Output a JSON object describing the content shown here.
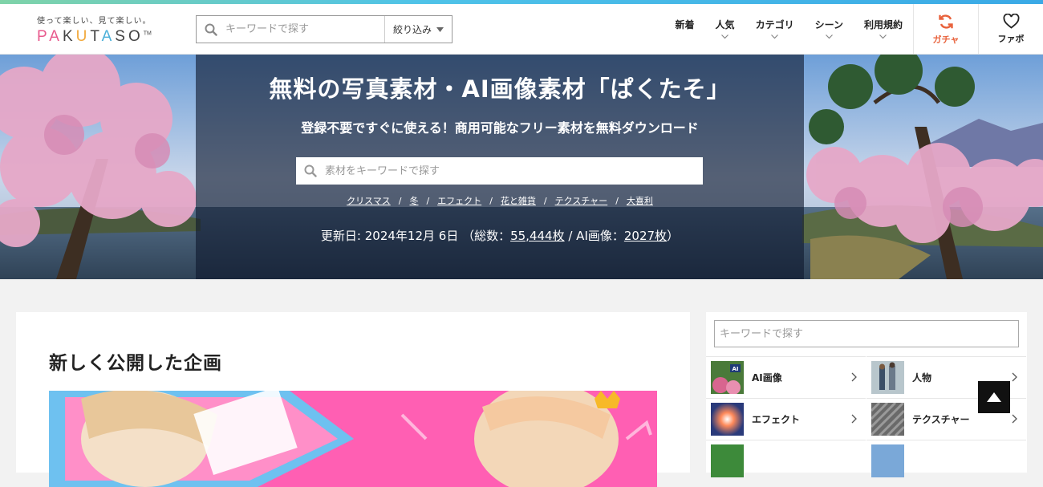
{
  "header": {
    "logo_tagline": "使って楽しい、見て楽しい。",
    "logo_parts": [
      "PA",
      "K",
      "U",
      "T",
      "A",
      "S",
      "O"
    ],
    "logo_tm": "TM",
    "search_placeholder": "キーワードで探す",
    "filter_label": "絞り込み",
    "nav": [
      {
        "label": "新着"
      },
      {
        "label": "人気"
      },
      {
        "label": "カテゴリ"
      },
      {
        "label": "シーン"
      },
      {
        "label": "利用規約"
      }
    ],
    "gacha_label": "ガチャ",
    "fav_label": "ファボ"
  },
  "hero": {
    "title": "無料の写真素材・AI画像素材「ぱくたそ」",
    "subtitle": "登録不要ですぐに使える！商用可能なフリー素材を無料ダウンロード",
    "search_placeholder": "素材をキーワードで探す",
    "tags": [
      "クリスマス",
      "冬",
      "エフェクト",
      "花と雑貨",
      "テクスチャー",
      "大喜利"
    ],
    "separator": "/",
    "update_prefix": "更新日: 2024年12月 6日 （総数：",
    "total_count": "55,444枚",
    "ai_prefix": " / AI画像：",
    "ai_count": "2027枚",
    "update_suffix": "）"
  },
  "main": {
    "section_title": "新しく公開した企画"
  },
  "sidebar": {
    "search_placeholder": "キーワードで探す",
    "categories": [
      {
        "label": "AI画像"
      },
      {
        "label": "人物"
      },
      {
        "label": "エフェクト"
      },
      {
        "label": "テクスチャー"
      }
    ],
    "thumb_badge": "AI"
  },
  "colors": {
    "accent_gacha": "#e8623c",
    "logo_pink": "#e85a8d",
    "logo_orange": "#f2a93b",
    "logo_blue": "#4bb0d9"
  },
  "icons": [
    "search-icon",
    "chevron-down-icon",
    "refresh-icon",
    "heart-icon",
    "chevron-right-icon",
    "arrow-up-icon"
  ]
}
